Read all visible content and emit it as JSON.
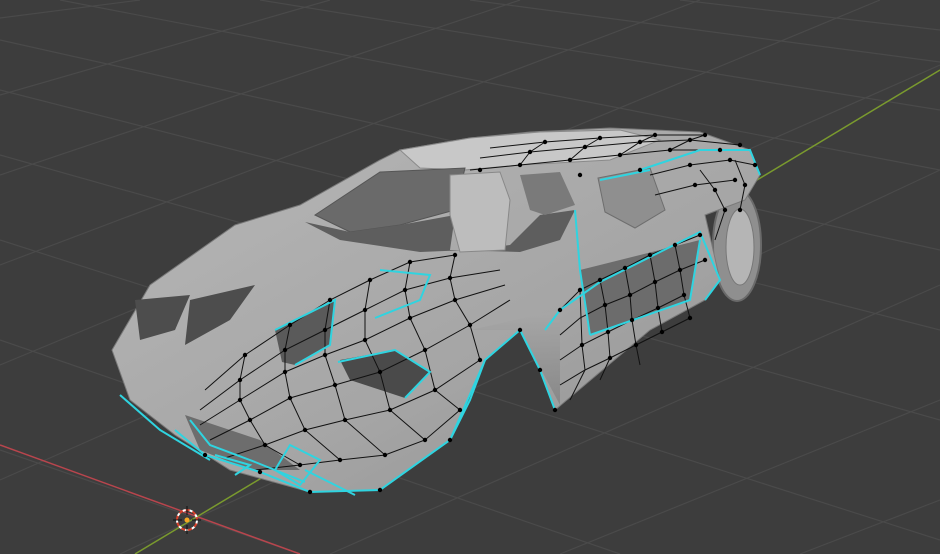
{
  "viewport": {
    "background": "#3d3d3d",
    "grid_color": "#4a4a4a",
    "x_axis_color": "#b8454d",
    "y_axis_color": "#7a9a2e"
  },
  "mesh": {
    "body_color": "#a9a9a9",
    "edge_color": "#111111",
    "seam_color": "#2fd4e0",
    "vertex_color": "#000000"
  },
  "icons": {
    "cursor": "3d-cursor-icon",
    "origin": "object-origin-icon"
  }
}
